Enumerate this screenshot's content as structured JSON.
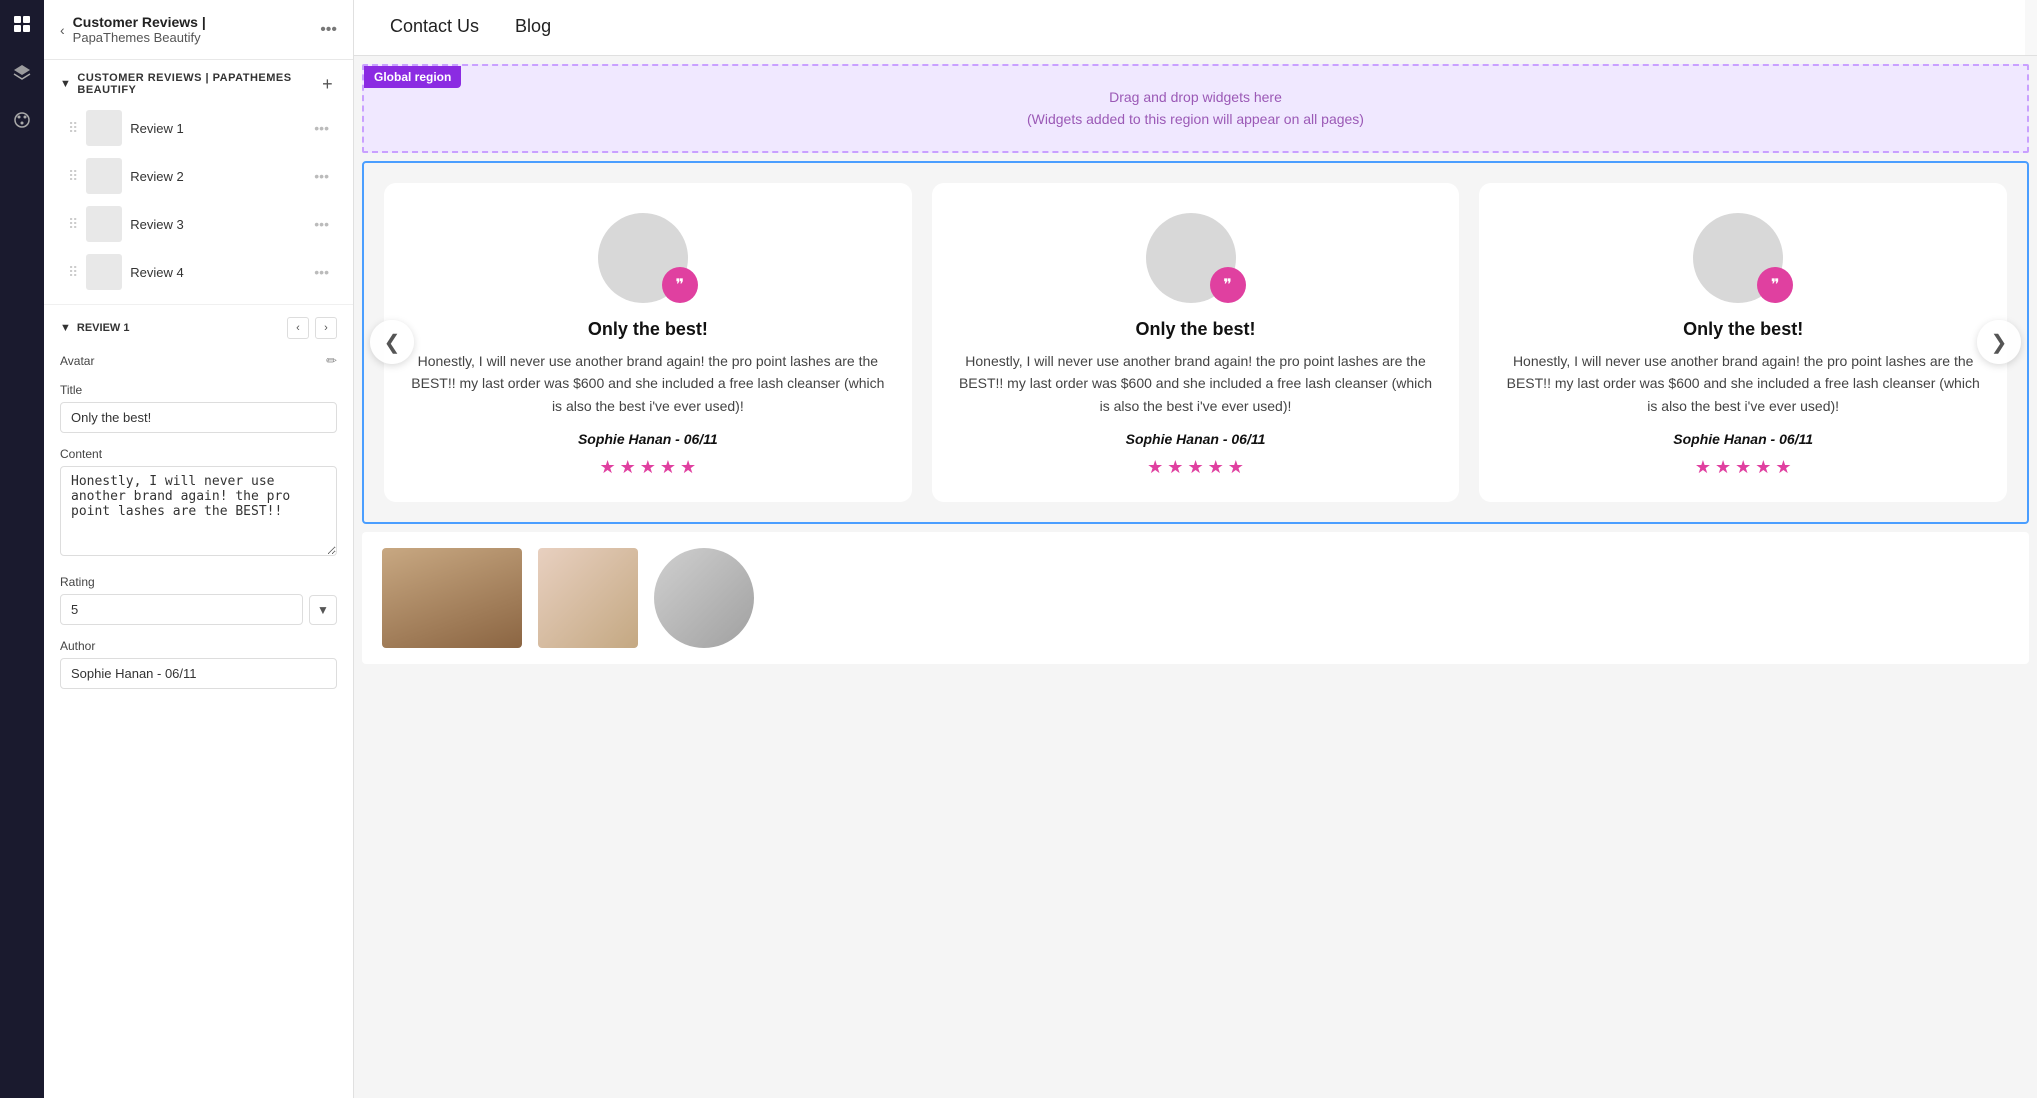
{
  "leftToolbar": {
    "icons": [
      "grid-icon",
      "layers-icon",
      "palette-icon"
    ]
  },
  "sidebar": {
    "header": {
      "backLabel": "‹",
      "title": "Customer Reviews |",
      "subtitle": "PapaThemes Beautify",
      "moreLabel": "•••"
    },
    "sectionGroup": {
      "title": "CUSTOMER REVIEWS | PAPATHEMES BEAUTIFY",
      "addLabel": "+"
    },
    "reviewItems": [
      {
        "name": "Review 1"
      },
      {
        "name": "Review 2"
      },
      {
        "name": "Review 3"
      },
      {
        "name": "Review 4"
      }
    ],
    "review1Section": {
      "title": "REVIEW 1",
      "navPrev": "‹",
      "navNext": "›",
      "fields": {
        "avatarLabel": "Avatar",
        "titleLabel": "Title",
        "titleValue": "Only the best!",
        "contentLabel": "Content",
        "contentValue": "Honestly, I will never use another brand again! the pro point lashes are the BEST!!",
        "ratingLabel": "Rating",
        "ratingValue": "5",
        "authorLabel": "Author",
        "authorValue": "Sophie Hanan - 06/11"
      }
    }
  },
  "navTabs": {
    "tabs": [
      {
        "label": "Contact Us",
        "active": false
      },
      {
        "label": "Blog",
        "active": false
      }
    ]
  },
  "globalRegion": {
    "badgeLabel": "Global region",
    "dragText": "Drag and drop widgets here",
    "subText": "(Widgets added to this region will appear on all pages)"
  },
  "reviewsSection": {
    "cards": [
      {
        "title": "Only the best!",
        "text": "Honestly, I will never use another brand again! the pro point lashes are the BEST!! my last order was $600 and she included a free lash cleanser (which is also the best i've ever used)!",
        "author": "Sophie Hanan - 06/11",
        "stars": 5
      },
      {
        "title": "Only the best!",
        "text": "Honestly, I will never use another brand again! the pro point lashes are the BEST!! my last order was $600 and she included a free lash cleanser (which is also the best i've ever used)!",
        "author": "Sophie Hanan - 06/11",
        "stars": 5
      },
      {
        "title": "Only the best!",
        "text": "Honestly, I will never use another brand again! the pro point lashes are the BEST!! my last order was $600 and she included a free lash cleanser (which is also the best i've ever used)!",
        "author": "Sophie Hanan - 06/11",
        "stars": 5
      }
    ],
    "carouselPrev": "❮",
    "carouselNext": "❯"
  }
}
